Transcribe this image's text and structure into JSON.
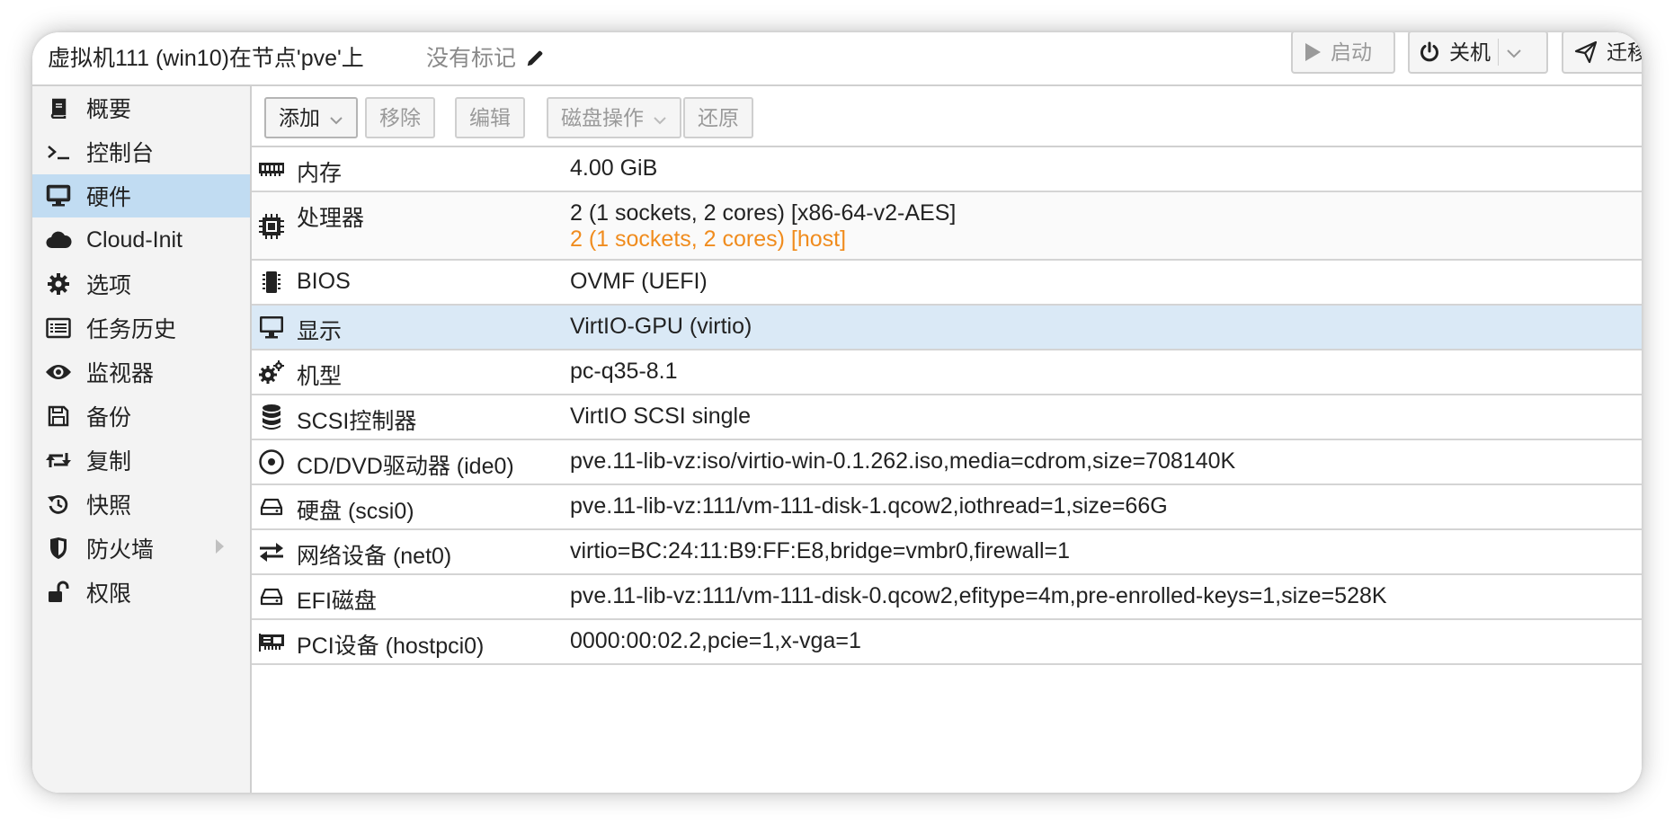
{
  "header": {
    "title": "虚拟机111 (win10)在节点'pve'上",
    "tags_label": "没有标记",
    "start_label": "启动",
    "shutdown_label": "关机",
    "migrate_label": "迁移"
  },
  "sidebar": {
    "items": [
      {
        "label": "概要",
        "icon": "book-icon"
      },
      {
        "label": "控制台",
        "icon": "terminal-icon"
      },
      {
        "label": "硬件",
        "icon": "desktop-icon",
        "selected": true
      },
      {
        "label": "Cloud-Init",
        "icon": "cloud-icon"
      },
      {
        "label": "选项",
        "icon": "gear-icon"
      },
      {
        "label": "任务历史",
        "icon": "list-icon"
      },
      {
        "label": "监视器",
        "icon": "eye-icon"
      },
      {
        "label": "备份",
        "icon": "floppy-icon"
      },
      {
        "label": "复制",
        "icon": "retweet-icon"
      },
      {
        "label": "快照",
        "icon": "history-icon"
      },
      {
        "label": "防火墙",
        "icon": "shield-icon",
        "has_submenu": true
      },
      {
        "label": "权限",
        "icon": "unlock-icon"
      }
    ]
  },
  "toolbar": {
    "add_label": "添加",
    "remove_label": "移除",
    "edit_label": "编辑",
    "disk_action_label": "磁盘操作",
    "revert_label": "还原"
  },
  "hardware": {
    "rows": [
      {
        "name": "内存",
        "value": "4.00 GiB",
        "icon": "memory-icon"
      },
      {
        "name": "处理器",
        "value": "2 (1 sockets, 2 cores) [x86-64-v2-AES]",
        "pending": "2 (1 sockets, 2 cores) [host]",
        "icon": "cpu-icon"
      },
      {
        "name": "BIOS",
        "value": "OVMF (UEFI)",
        "icon": "microchip-icon"
      },
      {
        "name": "显示",
        "value": "VirtIO-GPU (virtio)",
        "icon": "desktop-icon",
        "selected": true
      },
      {
        "name": "机型",
        "value": "pc-q35-8.1",
        "icon": "cogs-icon"
      },
      {
        "name": "SCSI控制器",
        "value": "VirtIO SCSI single",
        "icon": "database-icon"
      },
      {
        "name": "CD/DVD驱动器 (ide0)",
        "value": "pve.11-lib-vz:iso/virtio-win-0.1.262.iso,media=cdrom,size=708140K",
        "icon": "cdrom-icon"
      },
      {
        "name": "硬盘 (scsi0)",
        "value": "pve.11-lib-vz:111/vm-111-disk-1.qcow2,iothread=1,size=66G",
        "icon": "hdd-icon"
      },
      {
        "name": "网络设备 (net0)",
        "value": "virtio=BC:24:11:B9:FF:E8,bridge=vmbr0,firewall=1",
        "icon": "exchange-icon"
      },
      {
        "name": "EFI磁盘",
        "value": "pve.11-lib-vz:111/vm-111-disk-0.qcow2,efitype=4m,pre-enrolled-keys=1,size=528K",
        "icon": "hdd-icon"
      },
      {
        "name": "PCI设备 (hostpci0)",
        "value": "0000:00:02.2,pcie=1,x-vga=1",
        "icon": "pci-card-icon"
      }
    ]
  },
  "colors": {
    "selected_nav": "#c1dcf2",
    "selected_row": "#dae9f6",
    "pending_text": "#f08c1e"
  }
}
